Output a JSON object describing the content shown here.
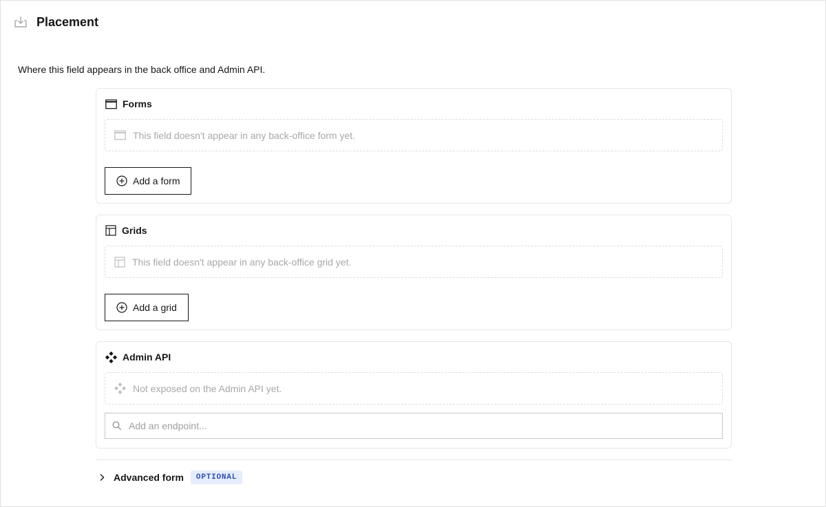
{
  "header": {
    "title": "Placement",
    "icon": "download-tray-icon"
  },
  "description": "Where this field appears in the back office and Admin API.",
  "sections": {
    "forms": {
      "title": "Forms",
      "icon": "window-icon",
      "empty_text": "This field doesn't appear in any back-office form yet.",
      "button_label": "Add a form"
    },
    "grids": {
      "title": "Grids",
      "icon": "table-icon",
      "empty_text": "This field doesn't appear in any back-office grid yet.",
      "button_label": "Add a grid"
    },
    "admin_api": {
      "title": "Admin API",
      "icon": "api-nodes-icon",
      "empty_text": "Not exposed on the Admin API yet.",
      "search_placeholder": "Add an endpoint..."
    }
  },
  "advanced": {
    "label": "Advanced form",
    "badge": "OPTIONAL"
  },
  "colors": {
    "badge_bg": "#e5ecfb",
    "badge_text": "#2f4fb5",
    "border": "#e6e6e6",
    "muted_text": "#a8a8a8"
  }
}
